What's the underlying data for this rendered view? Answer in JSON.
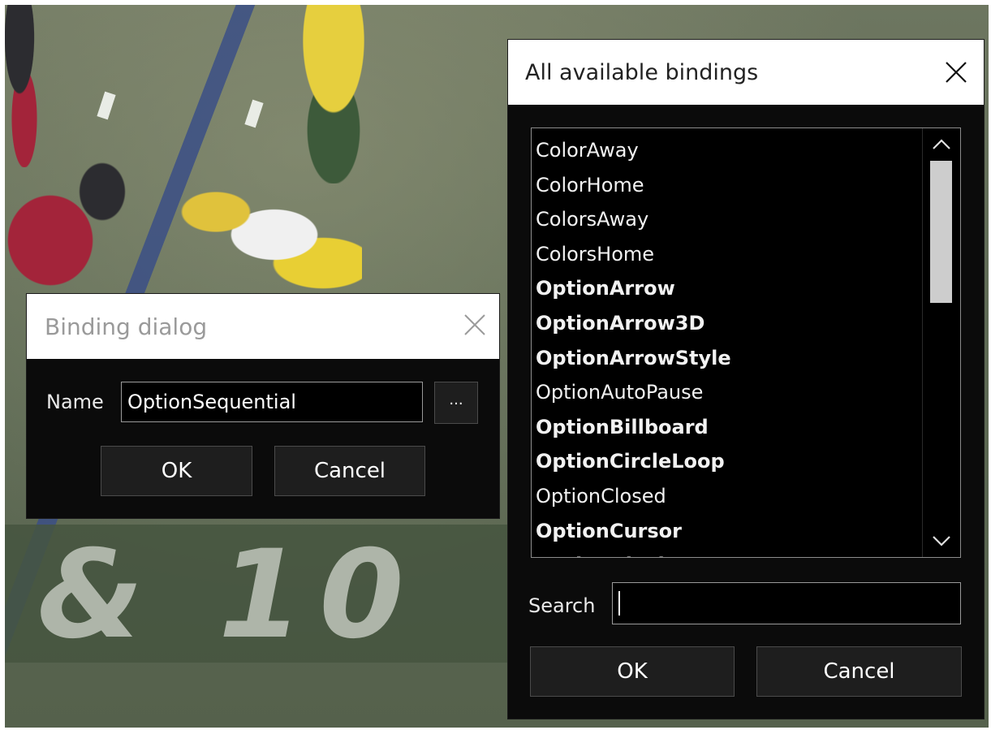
{
  "binding_dialog": {
    "title": "Binding dialog",
    "name_label": "Name",
    "name_value": "OptionSequential",
    "browse_label": "...",
    "ok_label": "OK",
    "cancel_label": "Cancel"
  },
  "bindings_dialog": {
    "title": "All available bindings",
    "items": [
      {
        "label": "ColorAway",
        "bold": false
      },
      {
        "label": "ColorHome",
        "bold": false
      },
      {
        "label": "ColorsAway",
        "bold": false
      },
      {
        "label": "ColorsHome",
        "bold": false
      },
      {
        "label": "OptionArrow",
        "bold": true
      },
      {
        "label": "OptionArrow3D",
        "bold": true
      },
      {
        "label": "OptionArrowStyle",
        "bold": true
      },
      {
        "label": "OptionAutoPause",
        "bold": false
      },
      {
        "label": "OptionBillboard",
        "bold": true
      },
      {
        "label": "OptionCircleLoop",
        "bold": true
      },
      {
        "label": "OptionClosed",
        "bold": false
      },
      {
        "label": "OptionCursor",
        "bold": true
      },
      {
        "label": "OptionDisplay",
        "bold": true
      }
    ],
    "search_label": "Search",
    "search_value": "",
    "ok_label": "OK",
    "cancel_label": "Cancel"
  },
  "background": {
    "field_text": "& 10"
  },
  "icons": {
    "close": "close-icon",
    "scroll_up": "chevron-up-icon",
    "scroll_down": "chevron-down-icon"
  }
}
